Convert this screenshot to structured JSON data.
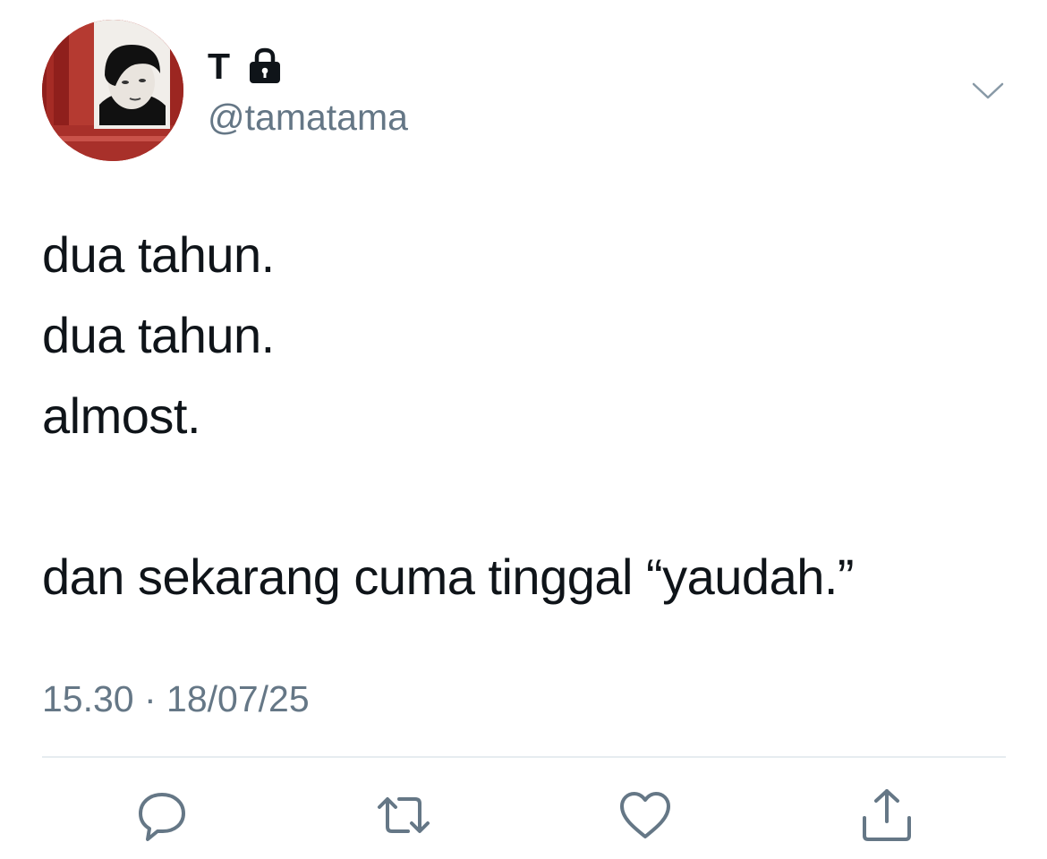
{
  "user": {
    "display_name": "T",
    "handle": "@tamatama",
    "protected": true,
    "avatar_icon": "profile-photo"
  },
  "tweet": {
    "lines": [
      "dua tahun.",
      "dua tahun.",
      "almost.",
      "",
      "dan sekarang cuma tinggal “yaudah.”"
    ],
    "timestamp": "15.30 · 18/07/25"
  },
  "actions": [
    {
      "icon": "reply-icon"
    },
    {
      "icon": "retweet-icon"
    },
    {
      "icon": "like-icon"
    },
    {
      "icon": "share-icon"
    }
  ],
  "colors": {
    "text": "#0f1419",
    "secondary": "#657786",
    "divider": "#e6ecf0",
    "icon": "#657786"
  }
}
